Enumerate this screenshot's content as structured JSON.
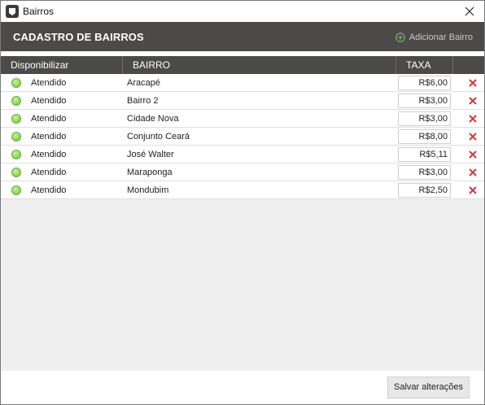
{
  "window": {
    "title": "Bairros",
    "close_icon": "close-icon"
  },
  "header": {
    "title": "CADASTRO DE BAIRROS",
    "add_label": "Adicionar Bairro",
    "add_icon": "plus-circle-icon"
  },
  "table": {
    "columns": [
      "Disponibilizar",
      "BAIRRO",
      "TAXA",
      ""
    ],
    "rows": [
      {
        "status": "Atendido",
        "bairro": "Aracapé",
        "taxa": "R$6,00"
      },
      {
        "status": "Atendido",
        "bairro": "Bairro 2",
        "taxa": "R$3,00"
      },
      {
        "status": "Atendido",
        "bairro": "Cidade Nova",
        "taxa": "R$3,00"
      },
      {
        "status": "Atendido",
        "bairro": "Conjunto Ceará",
        "taxa": "R$8,00"
      },
      {
        "status": "Atendido",
        "bairro": "José Walter",
        "taxa": "R$5,11"
      },
      {
        "status": "Atendido",
        "bairro": "Maraponga",
        "taxa": "R$3,00"
      },
      {
        "status": "Atendido",
        "bairro": "Mondubim",
        "taxa": "R$2,50"
      }
    ]
  },
  "footer": {
    "save_label": "Salvar alterações"
  },
  "colors": {
    "header_bg": "#4c4a49",
    "status_green": "#93d95c",
    "delete_red": "#d9363e"
  }
}
